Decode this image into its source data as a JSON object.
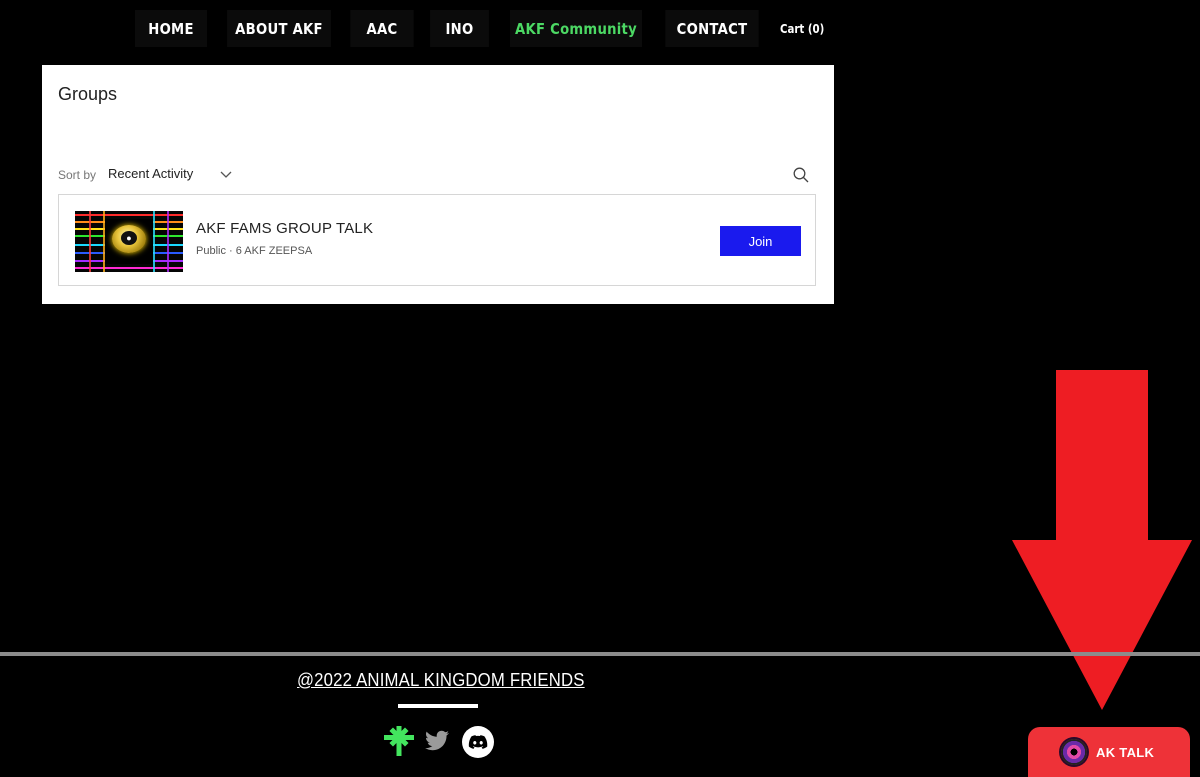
{
  "nav": {
    "items": [
      {
        "label": "HOME",
        "active": false
      },
      {
        "label": "ABOUT AKF",
        "active": false
      },
      {
        "label": "AAC",
        "active": false
      },
      {
        "label": "INO",
        "active": false
      },
      {
        "label": "AKF Community",
        "active": true
      },
      {
        "label": "CONTACT",
        "active": false
      }
    ],
    "cart_label": "Cart (0)",
    "active_color": "#4cd964"
  },
  "groups": {
    "title": "Groups",
    "sort_label": "Sort by",
    "sort_value": "Recent Activity",
    "search_icon": "search-icon",
    "items": [
      {
        "name": "AKF FAMS GROUP TALK",
        "meta": "Public · 6 AKF ZEEPSA",
        "join_label": "Join"
      }
    ],
    "join_color": "#1a1aee"
  },
  "footer": {
    "copyright": "@2022 ANIMAL KINGDOM FRIENDS",
    "social": [
      "linktree-icon",
      "twitter-icon",
      "discord-icon"
    ]
  },
  "chat": {
    "label": "AK TALK",
    "color": "#ee3238"
  },
  "annotation": {
    "arrow_color": "#ee1d23"
  }
}
